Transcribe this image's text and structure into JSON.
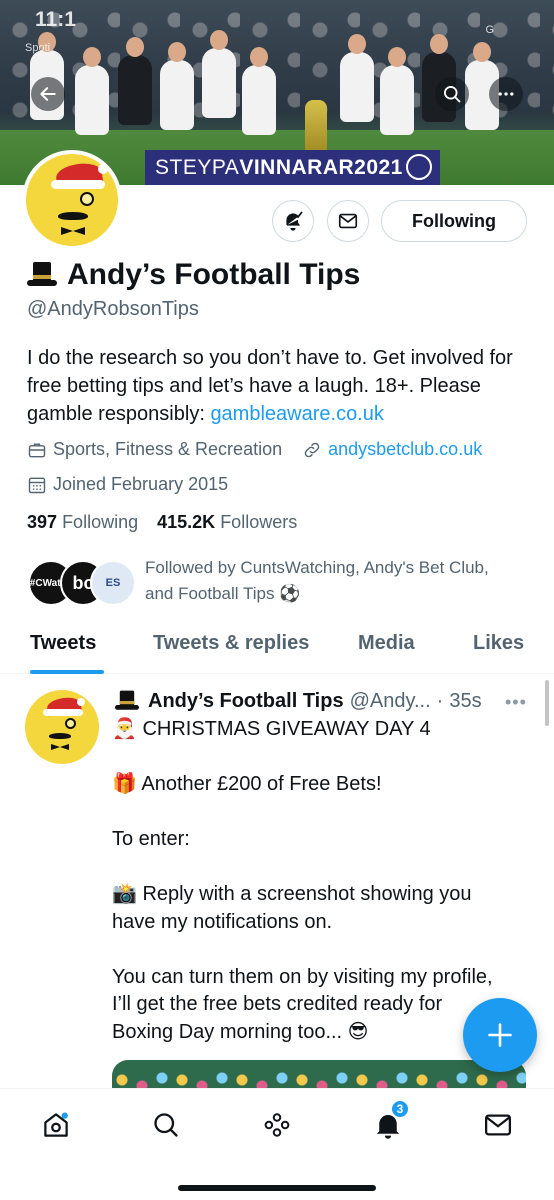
{
  "status_bar": {
    "time": "11:1",
    "sub_label": "Spoti",
    "right_label": "G"
  },
  "banner": {
    "sponsor_light": "STEYPA",
    "sponsor_bold": "VINNARAR2021"
  },
  "profile": {
    "name": "Andy’s Football Tips",
    "handle": "@AndyRobsonTips",
    "bio_text": "I do the research so you don’t have to. Get involved for free betting tips and let’s have a laugh. 18+. Please gamble responsibly: ",
    "bio_link": "gambleaware.co.uk",
    "category": "Sports, Fitness & Recreation",
    "website": "andysbetclub.co.uk",
    "joined": "Joined February 2015",
    "following_count": "397",
    "following_label": "Following",
    "followers_count": "415.2K",
    "followers_label": "Followers",
    "followed_by": "Followed by CuntsWatching, Andy's Bet Club, and Football Tips ⚽",
    "follow_button": "Following",
    "followed_avatars": [
      "#CWatch",
      "bc",
      "ES"
    ]
  },
  "tabs": [
    {
      "label": "Tweets",
      "active": true
    },
    {
      "label": "Tweets & replies",
      "active": false
    },
    {
      "label": "Media",
      "active": false
    },
    {
      "label": "Likes",
      "active": false
    }
  ],
  "tweet": {
    "author": "Andy’s Football Tips",
    "handle": "@Andy...",
    "sep": "·",
    "time": "35s",
    "lines": [
      "🎅 CHRISTMAS GIVEAWAY DAY 4",
      "",
      "🎁 Another £200 of Free Bets!",
      "",
      "To enter:",
      "",
      "📸 Reply with a screenshot showing you",
      "have my notifications on.",
      "",
      "You can turn them on by visiting my profile,",
      "I’ll get the free bets credited ready for",
      "Boxing Day morning too... 😎"
    ]
  },
  "nav": {
    "notifications_badge": "3"
  },
  "fab_label": "+",
  "colors": {
    "accent": "#1d9bf0",
    "text": "#0f1419",
    "muted": "#536471",
    "border": "#cfd9de"
  }
}
